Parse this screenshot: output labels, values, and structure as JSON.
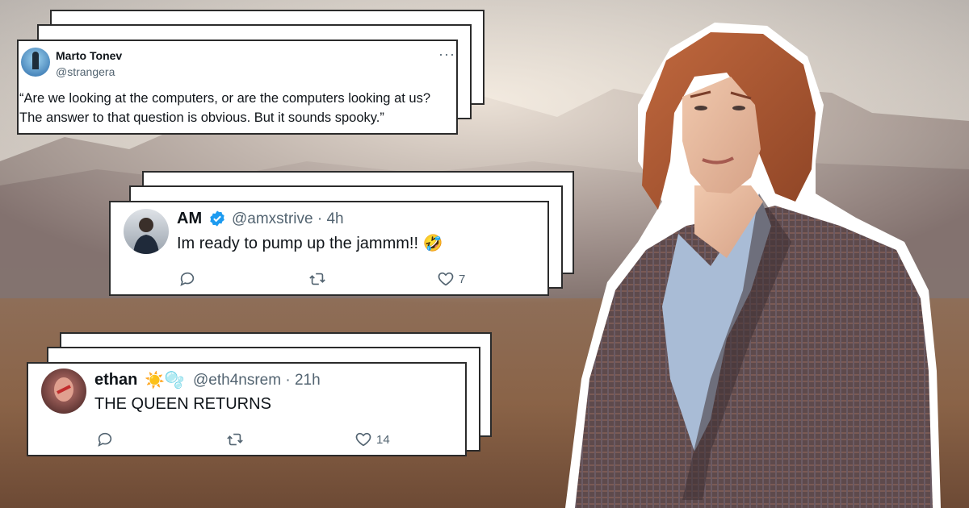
{
  "tweets": [
    {
      "name": "Marto Tonev",
      "handle": "@strangera",
      "more_icon": "more-horizontal-icon",
      "lines": [
        "“Are we looking at the computers, or are the computers looking at us?",
        "The answer to that question is obvious. But it sounds spooky.”"
      ]
    },
    {
      "name": "AM",
      "verified_icon": "verified-badge-icon",
      "handle_time": "@amxstrive · 4h",
      "text": "Im ready to pump up the jammm!! 🤣",
      "likes": "7"
    },
    {
      "name": "ethan",
      "name_emoji": "☀️🫧",
      "handle_time": "@eth4nsrem · 21h",
      "text": "THE QUEEN RETURNS",
      "likes": "14"
    }
  ],
  "icons": {
    "reply": "reply-icon",
    "retweet": "retweet-icon",
    "like": "like-icon"
  },
  "colors": {
    "card_border": "#2b2b2b",
    "secondary_text": "#536471",
    "verified_blue": "#1d9bf0"
  }
}
